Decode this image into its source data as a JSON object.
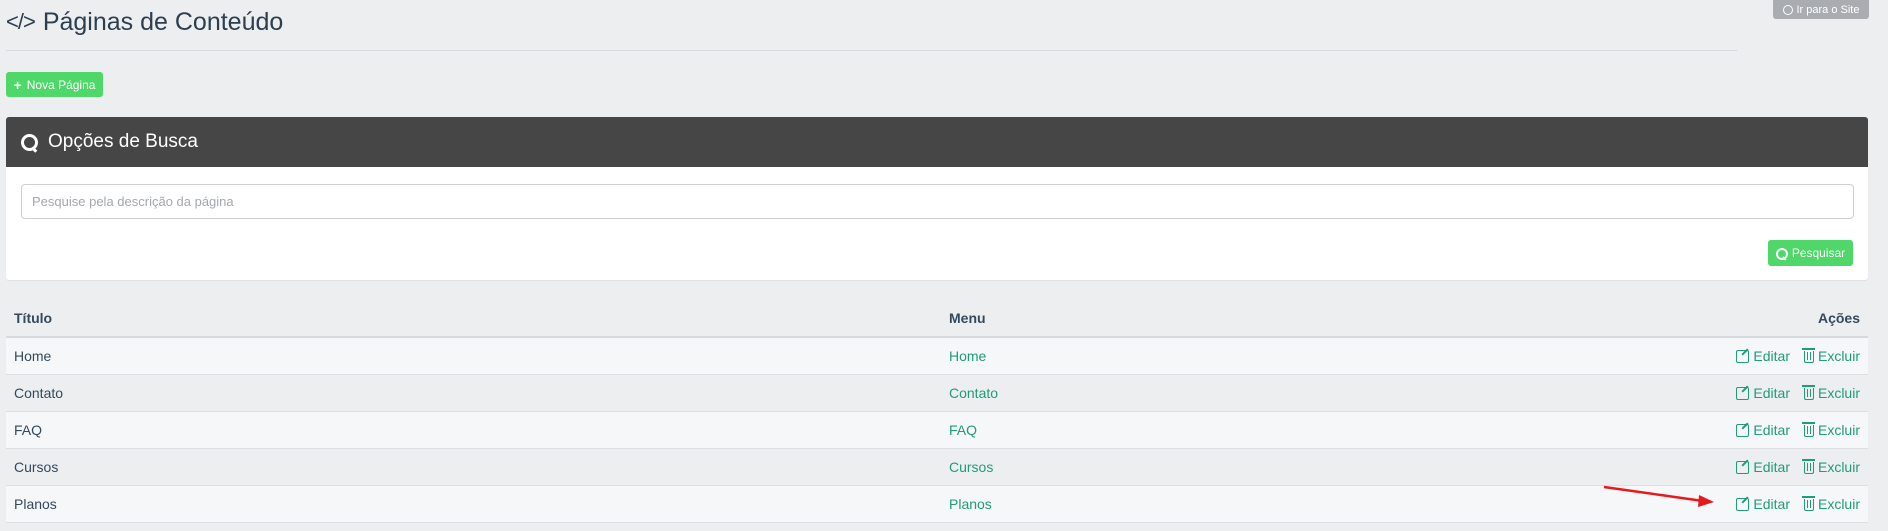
{
  "header": {
    "title": "Páginas de Conteúdo",
    "site_button": "Ir para o Site"
  },
  "toolbar": {
    "new_page_label": "Nova Página"
  },
  "search": {
    "panel_title": "Opções de Busca",
    "placeholder": "Pesquise pela descrição da página",
    "button_label": "Pesquisar"
  },
  "table": {
    "columns": [
      "Título",
      "Menu",
      "Ações"
    ],
    "rows": [
      {
        "title": "Home",
        "menu": "Home",
        "edit": "Editar",
        "delete": "Excluir"
      },
      {
        "title": "Contato",
        "menu": "Contato",
        "edit": "Editar",
        "delete": "Excluir"
      },
      {
        "title": "FAQ",
        "menu": "FAQ",
        "edit": "Editar",
        "delete": "Excluir"
      },
      {
        "title": "Cursos",
        "menu": "Cursos",
        "edit": "Editar",
        "delete": "Excluir"
      },
      {
        "title": "Planos",
        "menu": "Planos",
        "edit": "Editar",
        "delete": "Excluir"
      }
    ]
  },
  "icons": {
    "title": "code-icon",
    "site": "globe-icon",
    "new": "plus-icon",
    "search": "search-icon",
    "edit": "edit-icon",
    "delete": "trash-icon"
  },
  "colors": {
    "accent_green": "#4fd869",
    "link_teal": "#1f9c7a",
    "panel_header": "#464646",
    "annotation_arrow": "#e8191c"
  }
}
